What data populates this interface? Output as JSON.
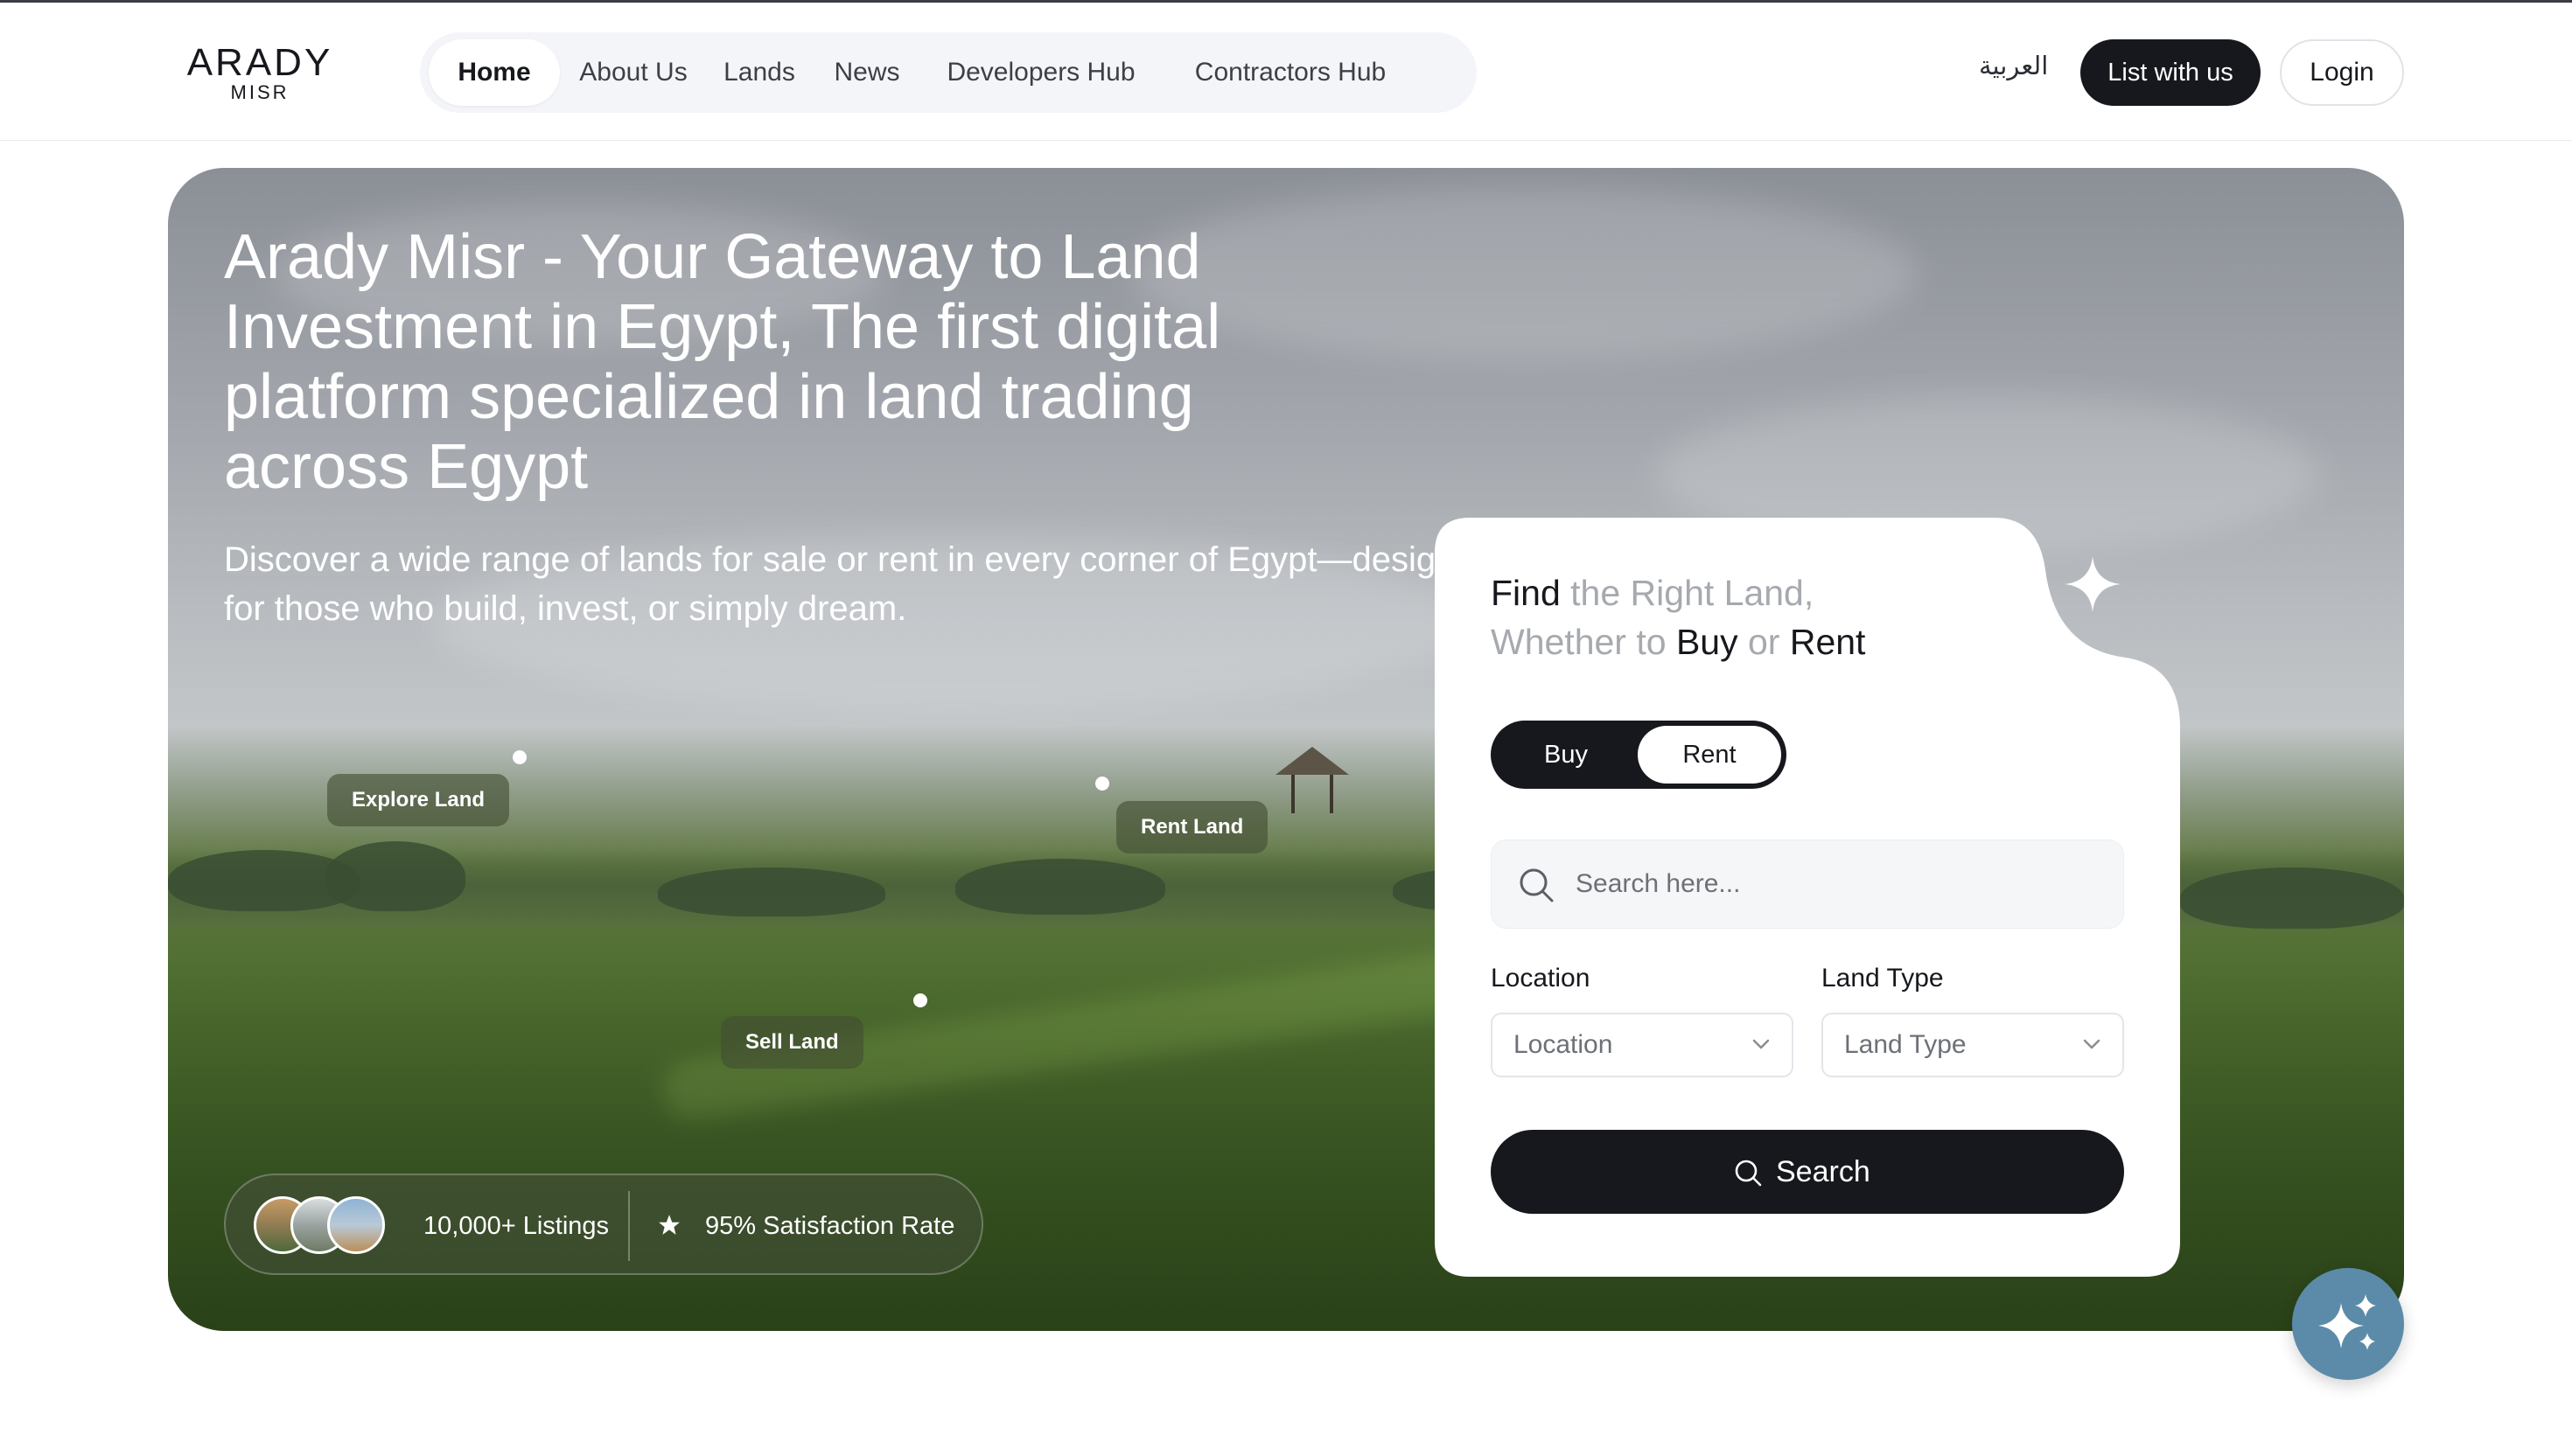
{
  "brand": {
    "name": "ARADY",
    "sub": "MISR"
  },
  "nav": {
    "items": [
      {
        "label": "Home"
      },
      {
        "label": "About Us"
      },
      {
        "label": "Lands"
      },
      {
        "label": "News"
      },
      {
        "label": "Developers Hub"
      },
      {
        "label": "Contractors Hub"
      }
    ]
  },
  "header": {
    "language_label": "العربية",
    "list_button": "List with us",
    "login_button": "Login"
  },
  "hero": {
    "title": "Arady Misr - Your Gateway to Land Investment in Egypt, The first digital platform specialized in land trading across Egypt",
    "subtitle": "Discover a wide range of lands for sale or rent in every corner of Egypt—designed for those who build, invest, or simply dream.",
    "pins": [
      {
        "label": "Explore Land"
      },
      {
        "label": "Rent Land"
      },
      {
        "label": "Sell Land"
      }
    ],
    "stats": {
      "listings": "10,000+ Listings",
      "satisfaction": "95% Satisfaction Rate"
    }
  },
  "search_card": {
    "title_find": "Find",
    "title_right_land": " the Right Land,",
    "title_whether": "Whether to ",
    "title_buy": "Buy",
    "title_or": " or ",
    "title_rent": "Rent",
    "toggle": {
      "buy": "Buy",
      "rent": "Rent",
      "selected": "Rent"
    },
    "search_placeholder": "Search here...",
    "location_label": "Location",
    "location_value": "Location",
    "land_type_label": "Land Type",
    "land_type_value": "Land Type",
    "search_button": "Search"
  },
  "icons": {
    "search": "search-icon",
    "star": "star-icon",
    "sparkle": "sparkle-icon",
    "chevron": "chevron-down-icon",
    "ai": "ai-sparkles-icon"
  },
  "colors": {
    "primary_dark": "#16181d",
    "nav_bg": "#f4f5f8",
    "ai_button": "#5b8ba8",
    "muted_text": "#a6a9ae"
  }
}
